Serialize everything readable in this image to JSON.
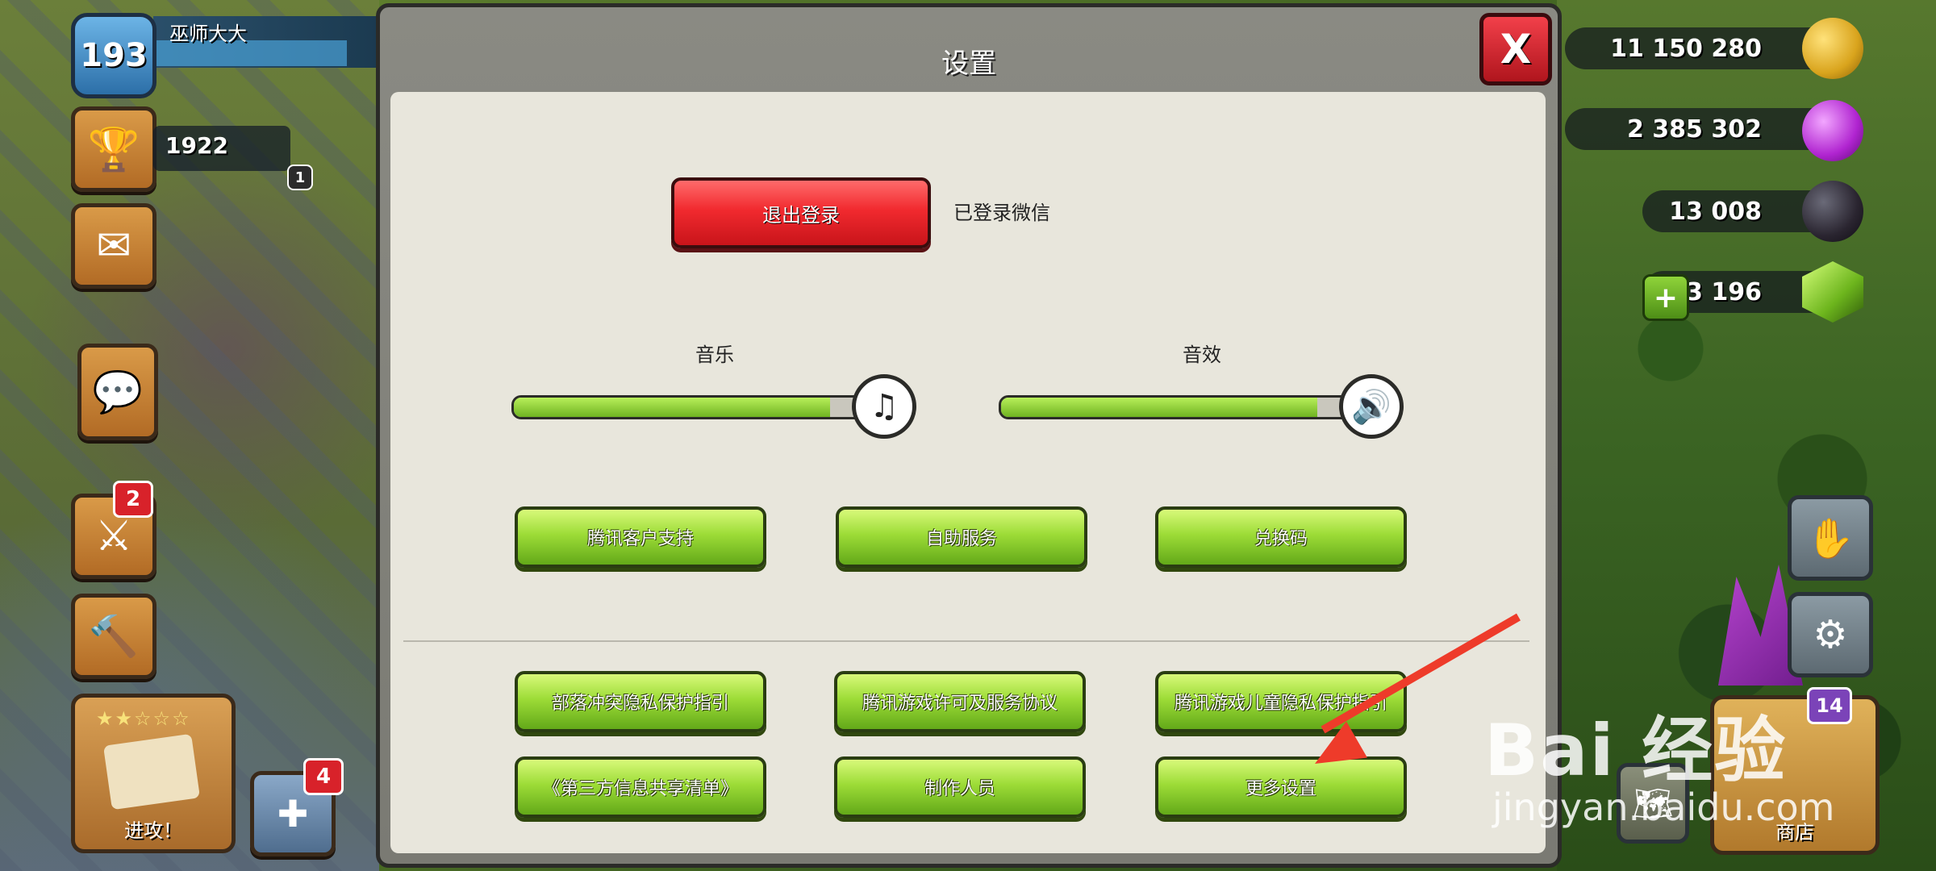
{
  "hud": {
    "level": "193",
    "player_name": "巫师大大",
    "trophies": "1922",
    "war_badge": "1",
    "battle_notif": "2",
    "shield_notif": "4",
    "attack_label": "进攻！",
    "shop_label": "商店",
    "shop_count": "14"
  },
  "resources": {
    "gold": "11 150 280",
    "elixir": "2 385 302",
    "dark_elixir": "13 008",
    "gems": "3 196"
  },
  "modal": {
    "title": "设置",
    "close_label": "X",
    "logout_label": "退出登录",
    "login_status": "已登录微信",
    "music_label": "音乐",
    "music_level": 0.83,
    "sfx_label": "音效",
    "sfx_level": 0.83,
    "row1": [
      "腾讯客户支持",
      "自助服务",
      "兑换码"
    ],
    "row2": [
      "部落冲突隐私保护指引",
      "腾讯游戏许可及服务协议",
      "腾讯游戏儿童隐私保护指引"
    ],
    "row3": [
      "《第三方信息共享清单》",
      "制作人员",
      "更多设置"
    ]
  },
  "watermark": {
    "brand": "Bai 经验",
    "url": "jingyan.baidu.com"
  },
  "colors": {
    "accent_green": "#9ddc37",
    "danger_red": "#f12a2f",
    "annotation_arrow": "#ee3b2a"
  }
}
